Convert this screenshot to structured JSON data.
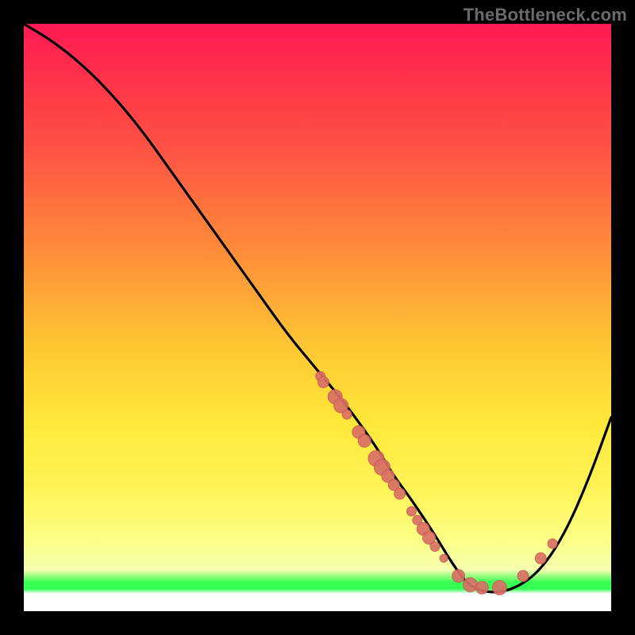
{
  "watermark": {
    "text": "TheBottleneck.com"
  },
  "colors": {
    "curve_stroke": "#000000",
    "marker_fill": "#d97066",
    "marker_stroke": "#c95b51"
  },
  "chart_data": {
    "type": "line",
    "title": "",
    "xlabel": "",
    "ylabel": "",
    "xlim": [
      0,
      100
    ],
    "ylim": [
      0,
      100
    ],
    "grid": false,
    "legend": false,
    "note": "No axis ticks or numeric labels visible; y values estimated as percent of plot height from bottom (0=bottom, 100=top). Curve resembles a bottleneck curve with minimum near x≈76.",
    "series": [
      {
        "name": "bottleneck-curve",
        "x": [
          0,
          5,
          10,
          15,
          20,
          25,
          30,
          35,
          40,
          45,
          50,
          55,
          60,
          63,
          66,
          70,
          73,
          76,
          80,
          84,
          88,
          92,
          96,
          100
        ],
        "y": [
          100,
          97,
          93,
          88,
          82,
          75,
          68,
          61,
          54,
          47,
          41,
          35,
          28,
          23,
          19,
          13,
          8,
          4,
          3,
          4,
          7,
          13,
          22,
          33
        ]
      }
    ],
    "markers": {
      "name": "highlighted-points",
      "comment": "Salmon dots clustered along the descending limb (~x 50–70) and a few on the ascending limb (~x 85–90). Sizes vary slightly.",
      "points": [
        {
          "x": 50.5,
          "y": 40.0,
          "r": 6
        },
        {
          "x": 51.0,
          "y": 39.0,
          "r": 7
        },
        {
          "x": 53.0,
          "y": 36.5,
          "r": 9
        },
        {
          "x": 54.0,
          "y": 35.0,
          "r": 9
        },
        {
          "x": 55.0,
          "y": 33.5,
          "r": 6
        },
        {
          "x": 57.0,
          "y": 30.5,
          "r": 8
        },
        {
          "x": 58.0,
          "y": 29.0,
          "r": 8
        },
        {
          "x": 60.0,
          "y": 26.0,
          "r": 10
        },
        {
          "x": 61.0,
          "y": 24.5,
          "r": 10
        },
        {
          "x": 62.0,
          "y": 23.0,
          "r": 8
        },
        {
          "x": 63.0,
          "y": 21.5,
          "r": 7
        },
        {
          "x": 64.0,
          "y": 20.0,
          "r": 7
        },
        {
          "x": 66.0,
          "y": 17.0,
          "r": 6
        },
        {
          "x": 67.0,
          "y": 15.5,
          "r": 6
        },
        {
          "x": 68.0,
          "y": 14.0,
          "r": 8
        },
        {
          "x": 69.0,
          "y": 12.5,
          "r": 8
        },
        {
          "x": 70.0,
          "y": 11.0,
          "r": 6
        },
        {
          "x": 71.5,
          "y": 9.0,
          "r": 5
        },
        {
          "x": 74.0,
          "y": 6.0,
          "r": 8
        },
        {
          "x": 76.0,
          "y": 4.5,
          "r": 9
        },
        {
          "x": 78.0,
          "y": 4.0,
          "r": 8
        },
        {
          "x": 81.0,
          "y": 4.0,
          "r": 9
        },
        {
          "x": 85.0,
          "y": 6.0,
          "r": 7
        },
        {
          "x": 88.0,
          "y": 9.0,
          "r": 7
        },
        {
          "x": 90.0,
          "y": 11.5,
          "r": 6
        }
      ]
    }
  }
}
